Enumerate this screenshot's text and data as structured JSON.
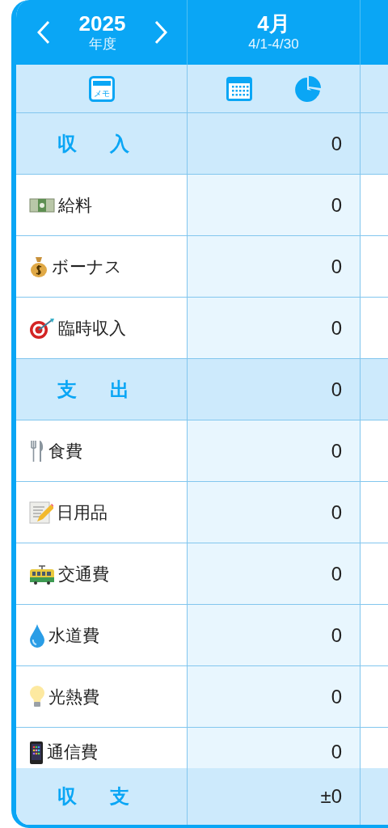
{
  "header": {
    "year": "2025",
    "year_caption": "年度",
    "month": "4月",
    "range": "4/1-4/30"
  },
  "toolbar": {
    "memo_label": "メモ"
  },
  "rows": [
    {
      "kind": "section",
      "label": "収 入",
      "value": "0"
    },
    {
      "kind": "item",
      "label": "給料",
      "value": "0"
    },
    {
      "kind": "item",
      "label": "ボーナス",
      "value": "0"
    },
    {
      "kind": "item",
      "label": "臨時収入",
      "value": "0"
    },
    {
      "kind": "section",
      "label": "支 出",
      "value": "0"
    },
    {
      "kind": "item",
      "label": "食費",
      "value": "0"
    },
    {
      "kind": "item",
      "label": "日用品",
      "value": "0"
    },
    {
      "kind": "item",
      "label": "交通費",
      "value": "0"
    },
    {
      "kind": "item",
      "label": "水道費",
      "value": "0"
    },
    {
      "kind": "item",
      "label": "光熱費",
      "value": "0"
    },
    {
      "kind": "item",
      "label": "通信費",
      "value": "0"
    }
  ],
  "footer": {
    "label": "収 支",
    "value": "±0"
  }
}
